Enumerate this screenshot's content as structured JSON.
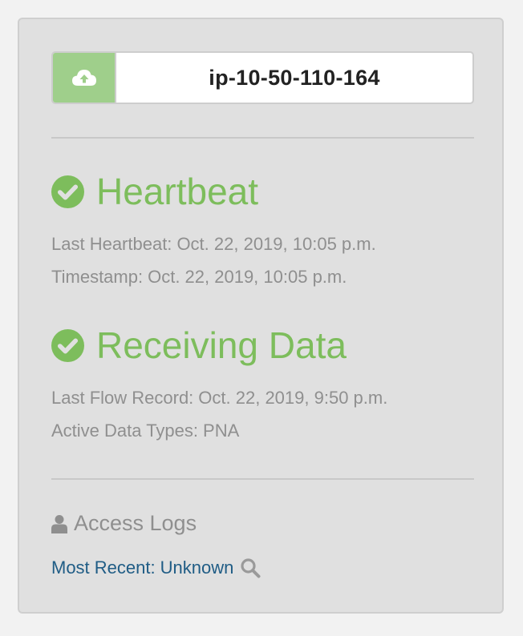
{
  "host": {
    "icon": "cloud-upload-icon",
    "name": "ip-10-50-110-164"
  },
  "heartbeat": {
    "title": "Heartbeat",
    "icon": "check-circle-icon",
    "last_label": "Last Heartbeat:",
    "last_value": "Oct. 22, 2019, 10:05 p.m.",
    "timestamp_label": "Timestamp:",
    "timestamp_value": "Oct. 22, 2019, 10:05 p.m."
  },
  "receiving": {
    "title": "Receiving Data",
    "icon": "check-circle-icon",
    "flow_label": "Last Flow Record:",
    "flow_value": "Oct. 22, 2019, 9:50 p.m.",
    "types_label": "Active Data Types:",
    "types_value": "PNA"
  },
  "access_logs": {
    "icon": "user-icon",
    "title": "Access Logs",
    "recent_label": "Most Recent:",
    "recent_value": "Unknown",
    "search_icon": "search-icon"
  },
  "colors": {
    "success": "#7dbd5c",
    "addon": "#9fcf8b",
    "link": "#1f5c85",
    "muted": "#8f8f8f",
    "panel": "#e0e0e0"
  }
}
